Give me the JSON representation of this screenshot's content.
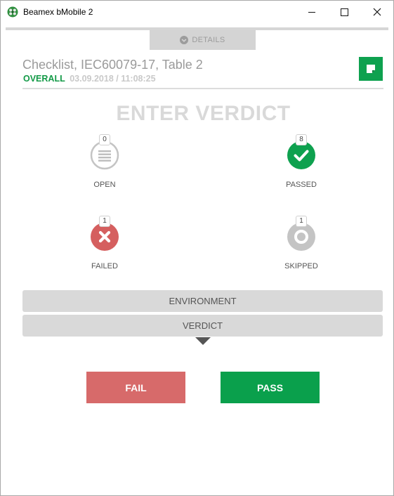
{
  "window": {
    "title": "Beamex bMobile 2",
    "icon": "beamex-app-icon"
  },
  "details_tab": {
    "label": "DETAILS",
    "icon": "chevron-down-circle-icon"
  },
  "header": {
    "title": "Checklist, IEC60079-17, Table 2",
    "overall_label": "OVERALL",
    "overall_date": "03.09.2018 / 11:08:25",
    "note_icon": "note-icon"
  },
  "verdict_heading": "ENTER VERDICT",
  "stats": {
    "open": {
      "label": "OPEN",
      "count": "0",
      "icon": "list-icon",
      "color": "#bdbdbd"
    },
    "passed": {
      "label": "PASSED",
      "count": "8",
      "icon": "check-icon",
      "color": "#0ea14f"
    },
    "failed": {
      "label": "FAILED",
      "count": "1",
      "icon": "x-icon",
      "color": "#d55f5f"
    },
    "skipped": {
      "label": "SKIPPED",
      "count": "1",
      "icon": "ring-icon",
      "color": "#c4c4c4"
    }
  },
  "sections": {
    "environment": "ENVIRONMENT",
    "verdict": "VERDICT"
  },
  "buttons": {
    "fail": "FAIL",
    "pass": "PASS"
  },
  "colors": {
    "brand_green": "#0ea14f",
    "fail_red": "#d76a6a",
    "section_gray": "#d9d9d9"
  }
}
